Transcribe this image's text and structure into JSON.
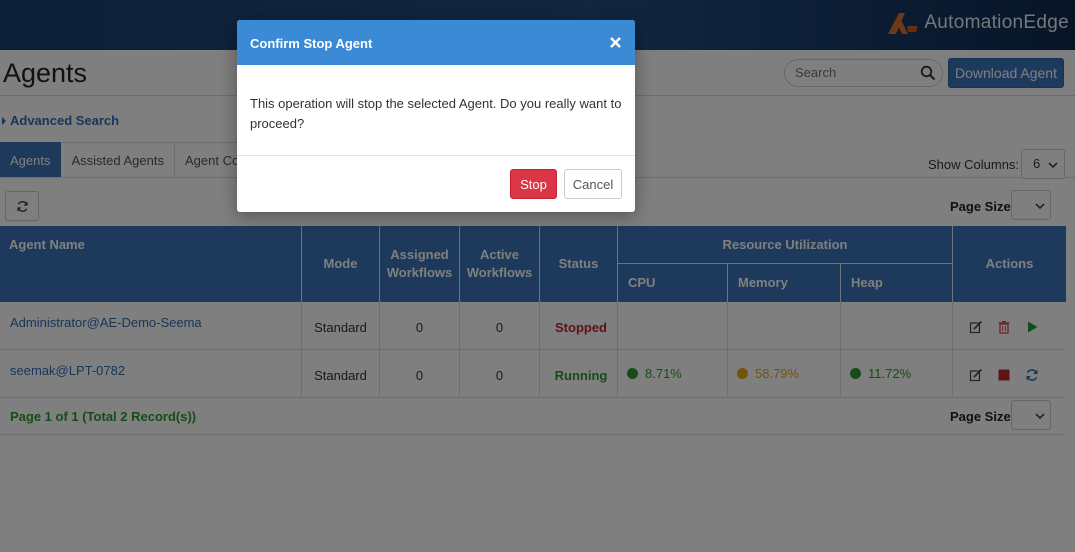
{
  "brand": {
    "name": "AutomationEdge",
    "logo_color": "#e0702a"
  },
  "page": {
    "title": "Agents"
  },
  "search": {
    "placeholder": "Search"
  },
  "toolbar": {
    "download_label": "Download Agent"
  },
  "advanced_search": {
    "label": "Advanced Search"
  },
  "tabs": [
    {
      "label": "Agents",
      "active": true
    },
    {
      "label": "Assisted Agents",
      "active": false
    },
    {
      "label": "Agent Con",
      "active": false
    }
  ],
  "columns_control": {
    "label": "Show Columns:",
    "value": "6"
  },
  "page_size": {
    "label": "Page Size"
  },
  "table": {
    "headers": {
      "agent_name": "Agent Name",
      "mode": "Mode",
      "assigned_line1": "Assigned",
      "assigned_line2": "Workflows",
      "active_line1": "Active",
      "active_line2": "Workflows",
      "status": "Status",
      "resource_utilization": "Resource Utilization",
      "cpu": "CPU",
      "memory": "Memory",
      "heap": "Heap",
      "actions": "Actions"
    },
    "rows": [
      {
        "agent_name": "Administrator@AE-Demo-Seema",
        "mode": "Standard",
        "assigned": "0",
        "active": "0",
        "status": "Stopped",
        "cpu": "",
        "memory": "",
        "heap": "",
        "actions": [
          "edit-icon",
          "delete-icon",
          "start-icon"
        ]
      },
      {
        "agent_name": "seemak@LPT-0782",
        "mode": "Standard",
        "assigned": "0",
        "active": "0",
        "status": "Running",
        "cpu": "8.71%",
        "memory": "58.79%",
        "heap": "11.72%",
        "actions": [
          "edit-icon",
          "stop-icon",
          "refresh-icon"
        ]
      }
    ],
    "colors": {
      "ok": "#2c9a2c",
      "warn": "#e6a817",
      "stopped": "#c0272d"
    }
  },
  "pager": {
    "text": "Page 1 of 1 (Total 2 Record(s))"
  },
  "modal": {
    "title": "Confirm Stop Agent",
    "message": "This operation will stop the selected Agent. Do you really want to proceed?",
    "confirm_label": "Stop",
    "cancel_label": "Cancel"
  }
}
